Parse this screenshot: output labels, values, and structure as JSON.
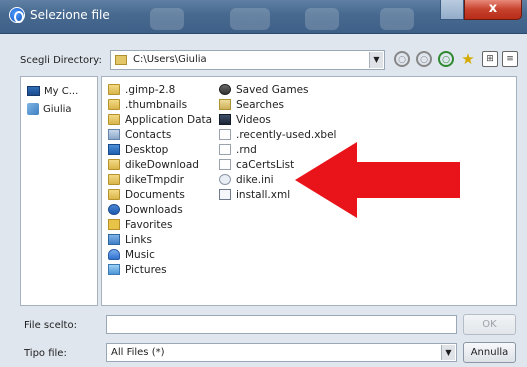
{
  "window": {
    "title": "Selezione file",
    "close_glyph": "x"
  },
  "toolbar": {
    "dir_label": "Scegli Directory:",
    "dir_path": "C:\\Users\\Giulia",
    "dropdown_arrow": "▼",
    "buttons": [
      {
        "icon": "back-icon",
        "glyph": "○"
      },
      {
        "icon": "up-icon",
        "glyph": "○"
      },
      {
        "icon": "new-folder-icon",
        "glyph": "○"
      },
      {
        "icon": "home-icon",
        "glyph": "★"
      },
      {
        "icon": "list-view-icon",
        "glyph": "⊞"
      },
      {
        "icon": "details-view-icon",
        "glyph": "≡"
      }
    ]
  },
  "left_pane": {
    "items": [
      {
        "label": "My C...",
        "icon": "computer-icon"
      },
      {
        "label": "Giulia",
        "icon": "user-folder-icon"
      }
    ]
  },
  "files": {
    "col1": [
      {
        "name": ".gimp-2.8",
        "icon": "folder-icon"
      },
      {
        "name": ".thumbnails",
        "icon": "folder-icon"
      },
      {
        "name": "Application Data",
        "icon": "folder-icon"
      },
      {
        "name": "Contacts",
        "icon": "contacts-icon"
      },
      {
        "name": "Desktop",
        "icon": "desktop-icon"
      },
      {
        "name": "dikeDownload",
        "icon": "folder-icon"
      },
      {
        "name": "dikeTmpdir",
        "icon": "folder-icon"
      },
      {
        "name": "Documents",
        "icon": "folder-icon"
      },
      {
        "name": "Downloads",
        "icon": "downloads-icon"
      },
      {
        "name": "Favorites",
        "icon": "favorites-icon"
      },
      {
        "name": "Links",
        "icon": "links-icon"
      },
      {
        "name": "Music",
        "icon": "music-icon"
      },
      {
        "name": "Pictures",
        "icon": "pictures-icon"
      }
    ],
    "col2": [
      {
        "name": "Saved Games",
        "icon": "saved-games-icon"
      },
      {
        "name": "Searches",
        "icon": "searches-icon"
      },
      {
        "name": "Videos",
        "icon": "videos-icon"
      },
      {
        "name": ".recently-used.xbel",
        "icon": "document-icon"
      },
      {
        "name": ".rnd",
        "icon": "document-icon"
      },
      {
        "name": "caCertsList",
        "icon": "document-icon"
      },
      {
        "name": "dike.ini",
        "icon": "ini-file-icon"
      },
      {
        "name": "install.xml",
        "icon": "xml-file-icon"
      }
    ]
  },
  "bottom": {
    "file_label": "File scelto:",
    "file_value": "",
    "ok_label": "OK",
    "type_label": "Tipo file:",
    "type_value": "All Files (*)",
    "cancel_label": "Annulla"
  },
  "colors": {
    "annotation_arrow": "#e8141a",
    "titlebar": "#47698f"
  }
}
